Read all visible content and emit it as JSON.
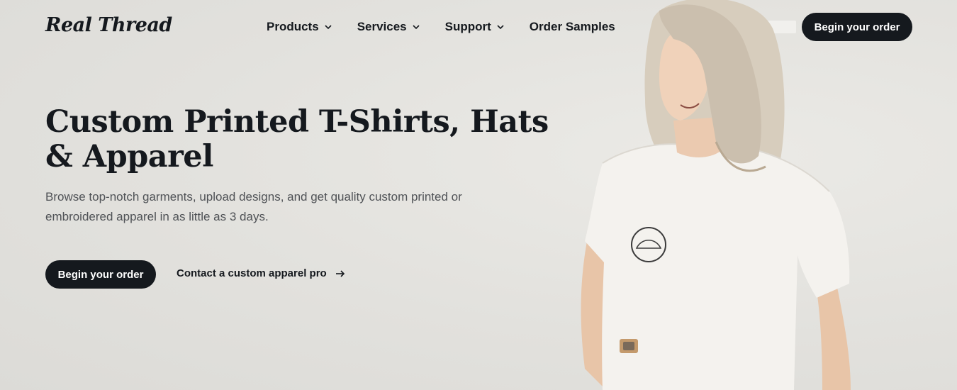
{
  "header": {
    "logo": "Real Thread",
    "nav": [
      {
        "label": "Products",
        "icon": "chevron-down-icon"
      },
      {
        "label": "Services",
        "icon": "chevron-down-icon"
      },
      {
        "label": "Support",
        "icon": "chevron-down-icon"
      },
      {
        "label": "Order Samples"
      }
    ],
    "cta": "Begin your order"
  },
  "hero": {
    "title": "Custom Printed T-Shirts, Hats & Apparel",
    "subtitle": "Browse top-notch garments, upload designs, and get quality custom printed or embroidered apparel in as little as 3 days.",
    "primary_cta": "Begin your order",
    "secondary_cta": "Contact a custom apparel pro"
  },
  "colors": {
    "background": "#e3e2de",
    "dark": "#15191e",
    "body_text": "#4f5256"
  }
}
